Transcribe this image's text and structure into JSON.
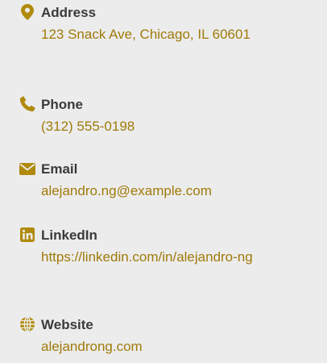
{
  "accent_color": "#b08a0c",
  "contacts": [
    {
      "icon": "map-pin-icon",
      "label": "Address",
      "value": "123 Snack Ave, Chicago, IL 60601"
    },
    {
      "icon": "phone-icon",
      "label": "Phone",
      "value": "(312) 555-0198"
    },
    {
      "icon": "envelope-icon",
      "label": "Email",
      "value": "alejandro.ng@example.com"
    },
    {
      "icon": "linkedin-icon",
      "label": "LinkedIn",
      "value": "https://linkedin.com/in/alejandro-ng"
    },
    {
      "icon": "globe-icon",
      "label": "Website",
      "value": "alejandrong.com"
    }
  ]
}
